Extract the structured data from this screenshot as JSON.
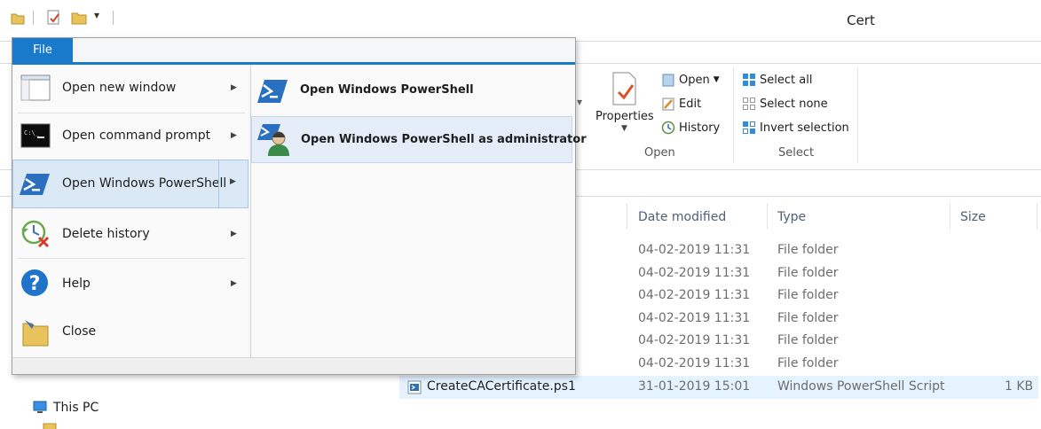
{
  "window": {
    "title": "Cert"
  },
  "quick_access": {
    "customize_glyph": "▾"
  },
  "ribbon": {
    "open_group": {
      "properties_label": "Properties",
      "open_label": "Open",
      "edit_label": "Edit",
      "history_label": "History",
      "group_label": "Open"
    },
    "select_group": {
      "select_all_label": "Select all",
      "select_none_label": "Select none",
      "invert_label": "Invert selection",
      "group_label": "Select"
    }
  },
  "file_menu": {
    "tab_label": "File",
    "items": [
      {
        "label": "Open new window",
        "icon": "window-icon",
        "has_submenu": true
      },
      {
        "label": "Open command prompt",
        "icon": "command-prompt-icon",
        "has_submenu": true
      },
      {
        "label": "Open Windows PowerShell",
        "icon": "powershell-icon",
        "has_submenu": true,
        "highlighted": true
      },
      {
        "label": "Delete history",
        "icon": "delete-history-icon",
        "has_submenu": true
      },
      {
        "label": "Help",
        "icon": "help-icon",
        "has_submenu": true
      },
      {
        "label": "Close",
        "icon": "close-folder-icon",
        "has_submenu": false
      }
    ],
    "submenu": [
      {
        "label": "Open Windows PowerShell",
        "icon": "powershell-icon"
      },
      {
        "label": "Open Windows PowerShell as administrator",
        "icon": "powershell-admin-icon",
        "highlighted": true
      }
    ]
  },
  "file_list": {
    "columns": [
      "Date modified",
      "Type",
      "Size"
    ],
    "rows": [
      {
        "name": "",
        "date": "04-02-2019 11:31",
        "type": "File folder",
        "size": ""
      },
      {
        "name": "",
        "date": "04-02-2019 11:31",
        "type": "File folder",
        "size": ""
      },
      {
        "name": "",
        "date": "04-02-2019 11:31",
        "type": "File folder",
        "size": ""
      },
      {
        "name": "",
        "date": "04-02-2019 11:31",
        "type": "File folder",
        "size": ""
      },
      {
        "name": "",
        "date": "04-02-2019 11:31",
        "type": "File folder",
        "size": ""
      },
      {
        "name": "",
        "date": "04-02-2019 11:31",
        "type": "File folder",
        "size": ""
      },
      {
        "name": "CreateCACertificate.ps1",
        "date": "31-01-2019 15:01",
        "type": "Windows PowerShell Script",
        "size": "1 KB"
      }
    ]
  },
  "nav_pane": {
    "this_pc_label": "This PC"
  },
  "colors": {
    "accent": "#1979ca",
    "menu_highlight": "#dbe8f6"
  }
}
